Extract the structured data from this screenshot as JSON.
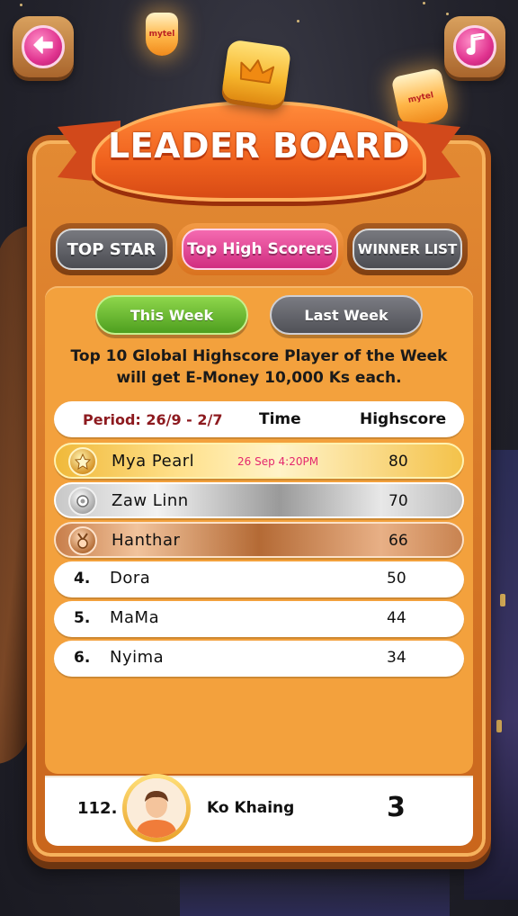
{
  "header": {
    "title": "LEADER BOARD",
    "back_icon": "arrow-left-icon",
    "music_icon": "music-note-icon",
    "badge_icon": "crown-icon"
  },
  "lanterns": [
    "mytel",
    "mytel"
  ],
  "tabs": [
    {
      "label": "TOP STAR",
      "active": false
    },
    {
      "label": "Top High Scorers",
      "active": true
    },
    {
      "label": "WINNER LIST",
      "active": false
    }
  ],
  "week_toggle": {
    "this_week": "This Week",
    "last_week": "Last Week",
    "selected": "This Week"
  },
  "promo": {
    "line1": "Top 10 Global Highscore Player of the Week",
    "line2": "will get E-Money 10,000 Ks each."
  },
  "table": {
    "period_label": "Period: 26/9 - 2/7",
    "col_time": "Time",
    "col_score": "Highscore",
    "rows": [
      {
        "rank": "1",
        "medal": "gold-medal-icon",
        "name": "Mya Pearl",
        "time": "26 Sep 4:20PM",
        "score": "80"
      },
      {
        "rank": "2",
        "medal": "silver-medal-icon",
        "name": "Zaw Linn",
        "time": "",
        "score": "70"
      },
      {
        "rank": "3",
        "medal": "bronze-medal-icon",
        "name": "Hanthar",
        "time": "",
        "score": "66"
      },
      {
        "rank": "4.",
        "name": "Dora",
        "time": "",
        "score": "50"
      },
      {
        "rank": "5.",
        "name": "MaMa",
        "time": "",
        "score": "44"
      },
      {
        "rank": "6.",
        "name": "Nyima",
        "time": "",
        "score": "34"
      }
    ]
  },
  "my_rank": {
    "rank": "112.",
    "name": "Ko Khaing",
    "score": "3",
    "avatar_icon": "user-avatar-icon"
  },
  "colors": {
    "accent_pink": "#d12d80",
    "accent_green": "#4e9f1f",
    "frame_orange": "#e38a33",
    "title_red": "#8d1a1f"
  }
}
